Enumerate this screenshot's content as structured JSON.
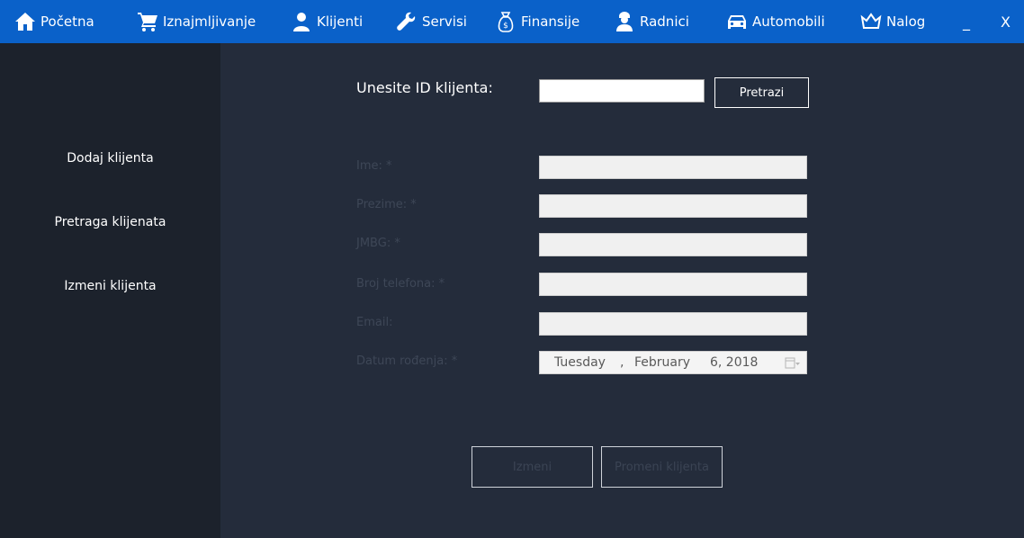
{
  "nav": {
    "items": [
      {
        "label": "Početna",
        "icon": "home-icon"
      },
      {
        "label": "Iznajmljivanje",
        "icon": "cart-icon"
      },
      {
        "label": "Klijenti",
        "icon": "user-icon"
      },
      {
        "label": "Servisi",
        "icon": "wrench-icon"
      },
      {
        "label": "Finansije",
        "icon": "money-bag-icon"
      },
      {
        "label": "Radnici",
        "icon": "worker-icon"
      },
      {
        "label": "Automobili",
        "icon": "car-icon"
      },
      {
        "label": "Nalog",
        "icon": "crown-icon"
      }
    ],
    "minimize_label": "_",
    "close_label": "X"
  },
  "sidebar": {
    "items": [
      {
        "label": "Dodaj klijenta"
      },
      {
        "label": "Pretraga klijenata"
      },
      {
        "label": "Izmeni klijenta"
      }
    ]
  },
  "search": {
    "label": "Unesite ID klijenta:",
    "value": "",
    "button_label": "Pretrazi"
  },
  "form": {
    "fields": [
      {
        "label": "Ime: *",
        "value": ""
      },
      {
        "label": "Prezime: *",
        "value": ""
      },
      {
        "label": "JMBG: *",
        "value": ""
      },
      {
        "label": "Broj telefona: *",
        "value": ""
      },
      {
        "label": "Email:",
        "value": ""
      }
    ],
    "date": {
      "label": "Datum rođenja:  *",
      "weekday": "Tuesday",
      "comma": ",",
      "month": "February",
      "day_year": "6, 2018"
    }
  },
  "actions": {
    "edit_label": "Izmeni",
    "change_client_label": "Promeni klijenta"
  },
  "colors": {
    "topbar": "#0a61c9",
    "sidebar": "#1c222c",
    "main": "#242c3b"
  }
}
